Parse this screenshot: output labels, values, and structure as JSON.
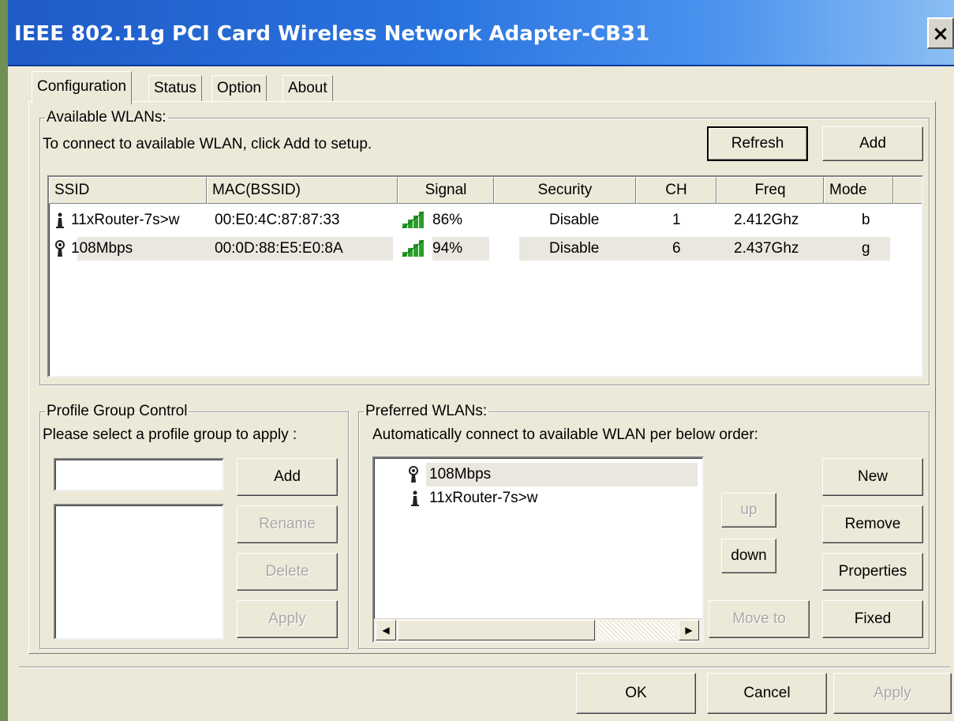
{
  "window": {
    "title": "IEEE 802.11g PCI Card Wireless Network Adapter-CB31",
    "close_label": "×"
  },
  "tabs": [
    "Configuration",
    "Status",
    "Option",
    "About"
  ],
  "available": {
    "legend": "Available WLANs:",
    "instruction": "To connect to available WLAN, click Add to setup.",
    "refresh_label": "Refresh",
    "add_label": "Add",
    "columns": [
      "SSID",
      "MAC(BSSID)",
      "Signal",
      "Security",
      "CH",
      "Freq",
      "Mode"
    ],
    "rows": [
      {
        "icon": "adhoc-station-icon",
        "ssid": "11xRouter-7s>w",
        "mac": "00:E0:4C:87:87:33",
        "signal": "86%",
        "security": "Disable",
        "ch": "1",
        "freq": "2.412Ghz",
        "mode": "b"
      },
      {
        "icon": "access-point-icon",
        "ssid": "108Mbps",
        "mac": "00:0D:88:E5:E0:8A",
        "signal": "94%",
        "security": "Disable",
        "ch": "6",
        "freq": "2.437Ghz",
        "mode": "g"
      }
    ]
  },
  "profile_group": {
    "legend": "Profile Group Control",
    "instruction": "Please select a profile group to apply :",
    "input_value": "",
    "add_label": "Add",
    "rename_label": "Rename",
    "delete_label": "Delete",
    "apply_label": "Apply"
  },
  "preferred": {
    "legend": "Preferred WLANs:",
    "instruction": "Automatically connect to available WLAN per below order:",
    "items": [
      {
        "icon": "access-point-icon",
        "name": "108Mbps"
      },
      {
        "icon": "adhoc-station-icon",
        "name": "11xRouter-7s>w"
      }
    ],
    "up_label": "up",
    "down_label": "down",
    "move_to_label": "Move to",
    "new_label": "New",
    "remove_label": "Remove",
    "properties_label": "Properties",
    "fixed_label": "Fixed"
  },
  "footer": {
    "ok_label": "OK",
    "cancel_label": "Cancel",
    "apply_label": "Apply"
  },
  "colors": {
    "titlebar": "#2a74e0",
    "dialog": "#ece9d8",
    "signal_bars": "#2aa02a"
  }
}
